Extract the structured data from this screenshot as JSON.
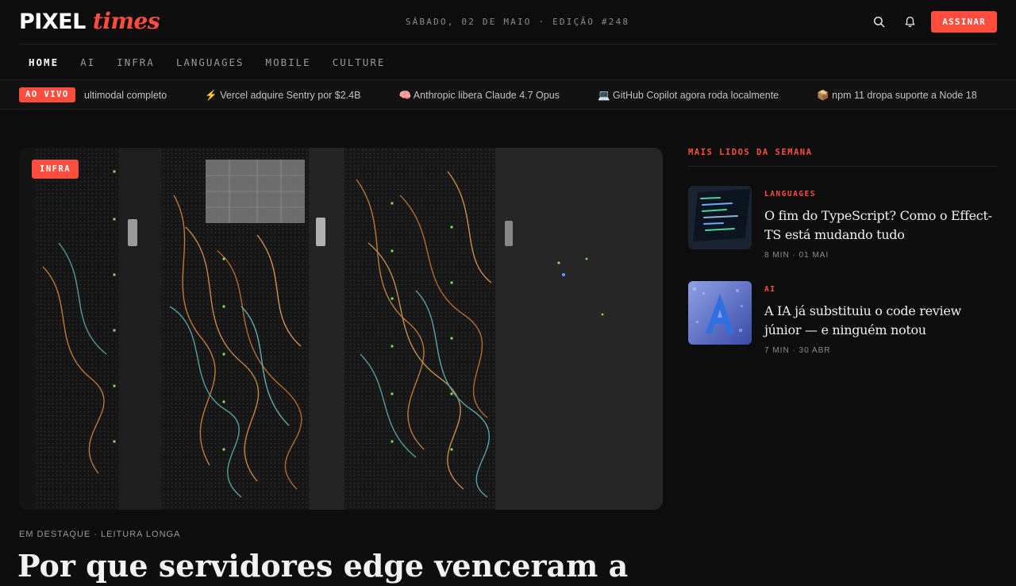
{
  "brand": {
    "word": "PIXEL",
    "accent": "times",
    "accent_color": "#ff4d3d"
  },
  "header": {
    "edition": "SÁBADO, 02 DE MAIO · EDIÇÃO #248",
    "search_icon": "search-icon",
    "bell_icon": "bell-icon",
    "subscribe_label": "ASSINAR"
  },
  "nav": {
    "items": [
      {
        "label": "HOME"
      },
      {
        "label": "AI"
      },
      {
        "label": "INFRA"
      },
      {
        "label": "LANGUAGES"
      },
      {
        "label": "MOBILE"
      },
      {
        "label": "CULTURE"
      }
    ],
    "active": "HOME"
  },
  "ticker": {
    "badge": "AO VIVO",
    "items": [
      {
        "text": "ultimodal completo"
      },
      {
        "text": "⚡ Vercel adquire Sentry por $2.4B"
      },
      {
        "text": "🧠 Anthropic libera Claude 4.7 Opus"
      },
      {
        "text": "💻 GitHub Copilot agora roda localmente"
      },
      {
        "text": "📦 npm 11 dropa suporte a Node 18"
      }
    ]
  },
  "featured": {
    "tag": "INFRA",
    "meta": "EM DESTAQUE · LEITURA LONGA",
    "title": "Por que servidores edge venceram a"
  },
  "sidebar": {
    "heading": "MAIS LIDOS DA SEMANA",
    "stories": [
      {
        "category": "LANGUAGES",
        "title": "O fim do TypeScript? Como o Effect-TS está mudando tudo",
        "meta": "8 MIN · 01 MAI"
      },
      {
        "category": "AI",
        "title": "A IA já substituiu o code review júnior — e ninguém notou",
        "meta": "7 MIN · 30 ABR"
      }
    ]
  }
}
